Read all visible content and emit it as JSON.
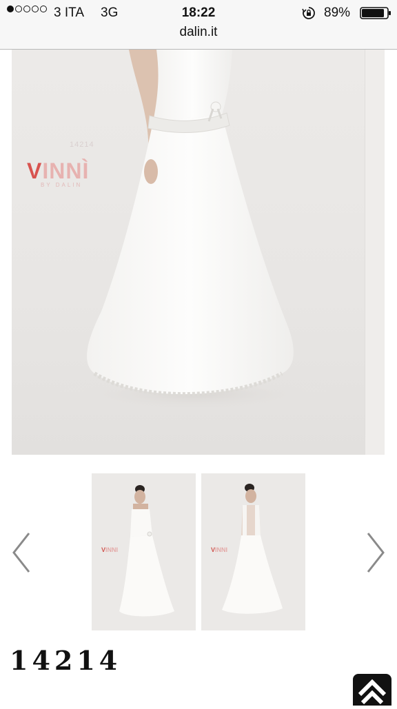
{
  "status_bar": {
    "carrier": "3 ITA",
    "network": "3G",
    "time": "18:22",
    "battery_percent": "89%",
    "signal_bars_filled": 1,
    "signal_bars_total": 5,
    "battery_level": 0.89
  },
  "browser": {
    "url": "dalin.it"
  },
  "main_photo": {
    "photo_code": "14214",
    "brand_first_letter": "V",
    "brand_rest": "INNÌ",
    "brand_sub": "BY DALIN"
  },
  "thumbnails": [
    {
      "brand_first_letter": "V",
      "brand_rest": "INNI",
      "view": "front"
    },
    {
      "brand_first_letter": "V",
      "brand_rest": "INNI",
      "view": "back"
    }
  ],
  "navigation": {
    "prev_icon": "chevron-left-icon",
    "next_icon": "chevron-right-icon",
    "top_icon": "chevron-up-icon"
  },
  "product": {
    "code": "14214"
  },
  "colors": {
    "brand_red": "#d8534f",
    "brand_pink": "#e7b2b0",
    "background": "#ebe9e7"
  }
}
